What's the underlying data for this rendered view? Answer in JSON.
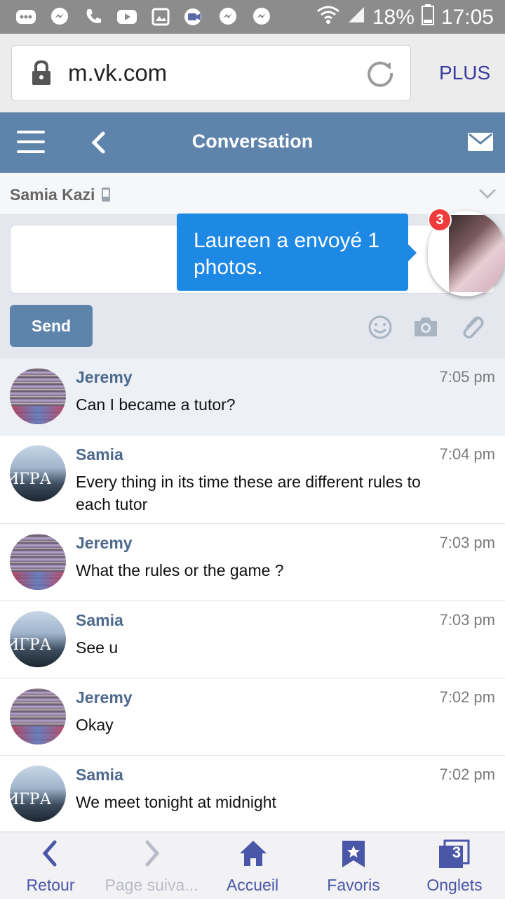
{
  "status_bar": {
    "battery": "18%",
    "time": "17:05",
    "icons": [
      "dots-icon",
      "messenger-icon",
      "phone-icon",
      "youtube-icon",
      "gallery-icon",
      "video-call-icon",
      "messenger-icon",
      "messenger-icon",
      "wifi-icon",
      "signal-icon",
      "battery-icon"
    ]
  },
  "browser": {
    "url": "m.vk.com",
    "more_label": "PLUS"
  },
  "header": {
    "title": "Conversation"
  },
  "conversation": {
    "name": "Samia Kazi"
  },
  "compose": {
    "send_label": "Send"
  },
  "notification": {
    "text": "Laureen a envoyé 1 photos.",
    "badge_count": "3"
  },
  "messages": [
    {
      "sender": "Jeremy",
      "time": "7:05 pm",
      "text": "Can I became a tutor?",
      "unread": true
    },
    {
      "sender": "Samia",
      "time": "7:04 pm",
      "text": "Every thing in its time these are different rules to each tutor",
      "unread": false
    },
    {
      "sender": "Jeremy",
      "time": "7:03 pm",
      "text": "What the rules or the game ?",
      "unread": false
    },
    {
      "sender": "Samia",
      "time": "7:03 pm",
      "text": "See u",
      "unread": false
    },
    {
      "sender": "Jeremy",
      "time": "7:02 pm",
      "text": "Okay",
      "unread": false
    },
    {
      "sender": "Samia",
      "time": "7:02 pm",
      "text": "We meet tonight at midnight",
      "unread": false
    }
  ],
  "bottom_nav": {
    "back": "Retour",
    "forward": "Page suiva...",
    "home": "Accueil",
    "bookmarks": "Favoris",
    "tabs": "Onglets",
    "tabs_count": "3"
  },
  "colors": {
    "header": "#5f84ac",
    "accent_blue": "#1e88e5",
    "sender_name": "#4d6a8e",
    "nav": "#4a56a8"
  }
}
